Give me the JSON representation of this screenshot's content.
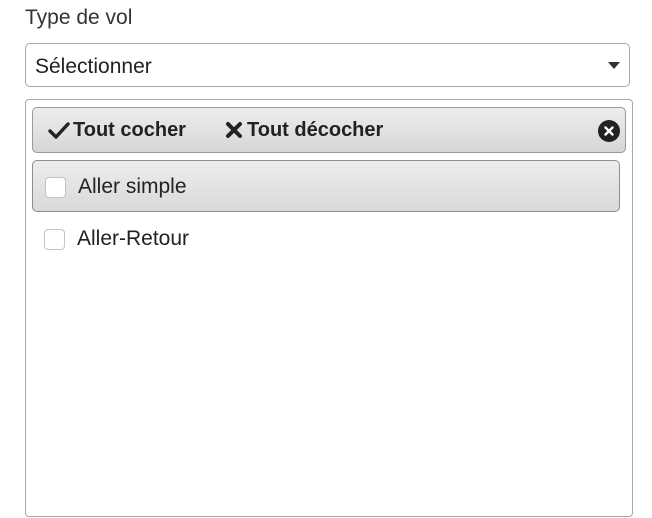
{
  "field": {
    "label": "Type de vol"
  },
  "select": {
    "value": "Sélectionner",
    "caret_icon": "caret-down-icon"
  },
  "dropdown": {
    "header": {
      "check_all_label": "Tout cocher",
      "check_all_icon": "checkmark-icon",
      "uncheck_all_label": "Tout décocher",
      "uncheck_all_icon": "x-mark-icon",
      "close_icon": "close-circle-icon"
    },
    "options": [
      {
        "label": "Aller simple",
        "checked": false,
        "highlighted": true
      },
      {
        "label": "Aller-Retour",
        "checked": false,
        "highlighted": false
      }
    ]
  }
}
